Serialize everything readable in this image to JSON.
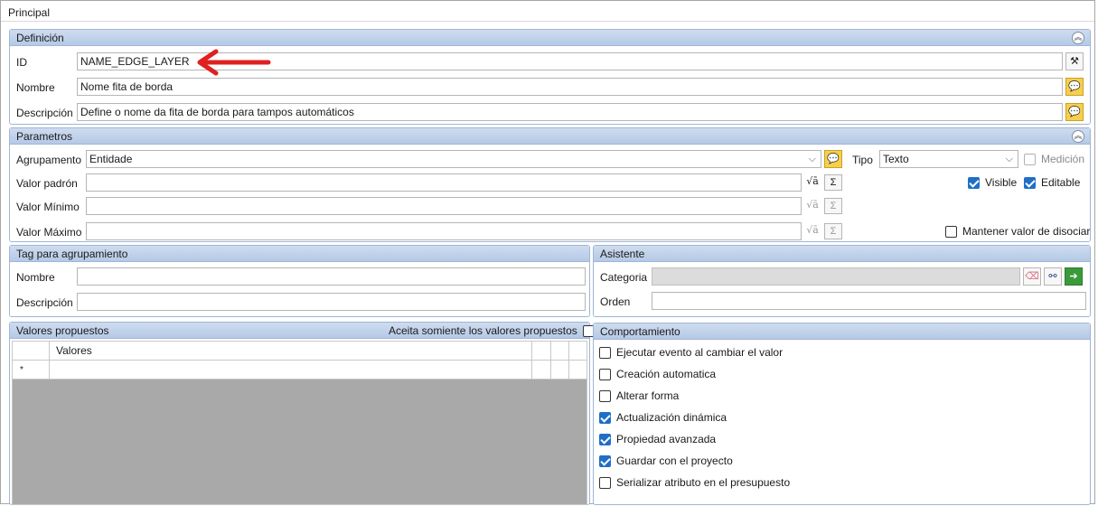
{
  "window": {
    "title": "Principal"
  },
  "definicion": {
    "header": "Definición",
    "id_label": "ID",
    "id_value": "NAME_EDGE_LAYER",
    "nombre_label": "Nombre",
    "nombre_value": "Nome fita de borda",
    "descripcion_label": "Descripción",
    "descripcion_value": "Define o nome da fita de borda para tampos automáticos"
  },
  "parametros": {
    "header": "Parametros",
    "agrupamento_label": "Agrupamento",
    "agrupamento_value": "Entidade",
    "tipo_label": "Tipo",
    "tipo_value": "Texto",
    "medicion_label": "Medición",
    "medicion_checked": false,
    "valor_padron_label": "Valor padrón",
    "valor_minimo_label": "Valor Mínimo",
    "valor_maximo_label": "Valor Máximo",
    "visible_label": "Visible",
    "visible_checked": true,
    "editable_label": "Editable",
    "editable_checked": true,
    "mantener_label": "Mantener valor de disociar",
    "mantener_checked": false
  },
  "tag": {
    "header": "Tag para agrupamiento",
    "nombre_label": "Nombre",
    "descripcion_label": "Descripción"
  },
  "asistente": {
    "header": "Asistente",
    "categoria_label": "Categoria",
    "orden_label": "Orden"
  },
  "valores": {
    "header": "Valores propuestos",
    "acepta_label": "Aceita somiente los valores propuestos",
    "acepta_checked": false,
    "column_header": "Valores",
    "new_row_marker": "*"
  },
  "comportamiento": {
    "header": "Comportamiento",
    "items": [
      {
        "label": "Ejecutar evento al cambiar el valor",
        "checked": false
      },
      {
        "label": "Creación automatica",
        "checked": false
      },
      {
        "label": "Alterar forma",
        "checked": false
      },
      {
        "label": "Actualización dinámica",
        "checked": true
      },
      {
        "label": "Propiedad avanzada",
        "checked": true
      },
      {
        "label": "Guardar con el proyecto",
        "checked": true
      },
      {
        "label": "Serializar atributo en el presupuesto",
        "checked": false
      }
    ]
  },
  "icons": {
    "collapse": "chevron-up-double-icon",
    "bubble": "speech-bubble-icon",
    "formula": "sqrt-formula-icon",
    "sigma": "sigma-icon",
    "eraser": "eraser-icon",
    "binoculars": "binoculars-icon",
    "go": "green-arrow-icon",
    "wizard": "wizard-icon"
  },
  "colors": {
    "header_bg": "#b5c9e6",
    "check_accent": "#1f6fc7",
    "annotation_arrow": "#e02020"
  }
}
